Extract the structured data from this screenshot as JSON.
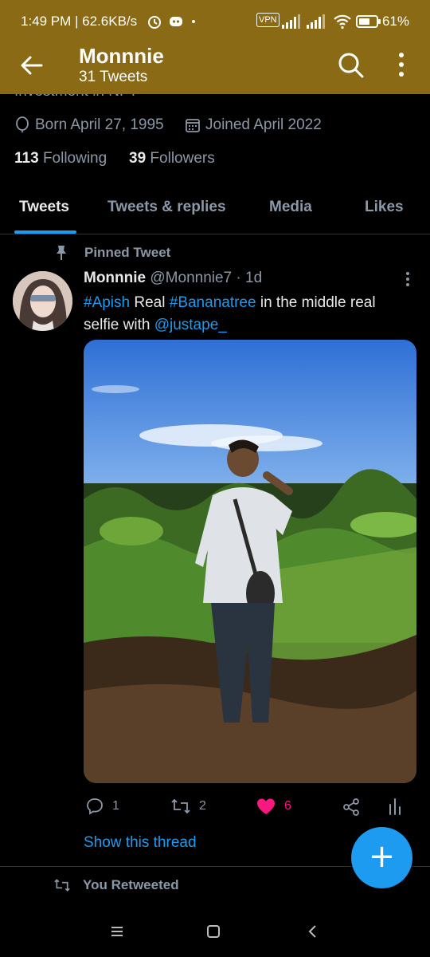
{
  "status_bar": {
    "time": "1:49 PM | 62.6KB/s",
    "vpn_label": "VPN",
    "battery_pct": "61%",
    "icons": [
      "alarm-icon",
      "discord-icon",
      "vpn-icon",
      "signal-icon",
      "wifi-icon",
      "battery-icon"
    ]
  },
  "header": {
    "title": "Monnnie",
    "subtitle": "31 Tweets",
    "bg_color": "#8a6a14"
  },
  "profile": {
    "truncated_bio": "Investment in NFT",
    "born": "Born April 27, 1995",
    "joined": "Joined April 2022",
    "following_count": "113",
    "following_label": "Following",
    "followers_count": "39",
    "followers_label": "Followers"
  },
  "tabs": [
    {
      "label": "Tweets",
      "active": true
    },
    {
      "label": "Tweets & replies",
      "active": false
    },
    {
      "label": "Media",
      "active": false
    },
    {
      "label": "Likes",
      "active": false
    }
  ],
  "tweet": {
    "pinned_label": "Pinned Tweet",
    "name": "Monnnie",
    "handle": "@Monnnie7",
    "separator": " · ",
    "age": "1d",
    "text_parts": [
      "#Apish",
      " Real ",
      "#Bananatree",
      " in the middle real selfie with ",
      "@justape_"
    ],
    "replies": "1",
    "retweets": "2",
    "likes": "6",
    "show_thread": "Show this thread"
  },
  "next_item": {
    "label": "You Retweeted"
  },
  "colors": {
    "accent": "#1d9bf0",
    "like": "#f91880",
    "muted": "#8b98a5",
    "text": "#e7e9ea"
  },
  "fab_icon": "plus-icon",
  "system_nav": [
    "menu-icon",
    "home-icon",
    "back-icon"
  ]
}
